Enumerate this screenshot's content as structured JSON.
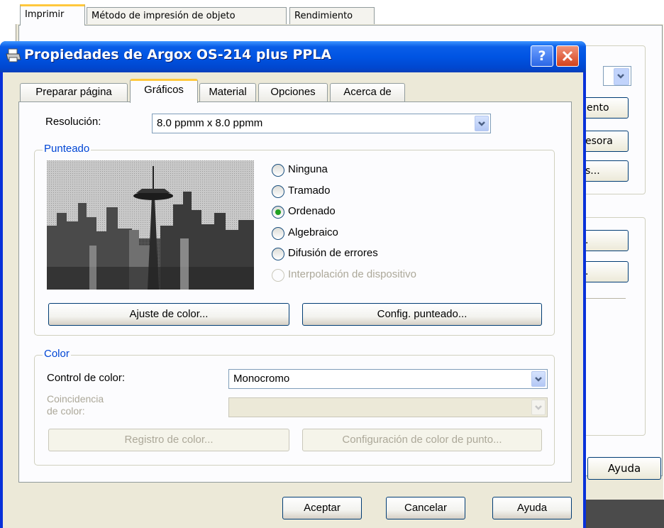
{
  "background_window": {
    "tabs": [
      "Imprimir",
      "Método de impresión de objeto",
      "Rendimiento"
    ],
    "buttons": [
      "ento",
      "esora",
      "s...",
      ".",
      "."
    ],
    "help_button": "Ayuda"
  },
  "dialog": {
    "title": "Propiedades de Argox OS-214 plus PPLA",
    "help_glyph": "?",
    "tabs": [
      "Preparar página",
      "Gráficos",
      "Material",
      "Opciones",
      "Acerca de"
    ],
    "active_tab": "Gráficos",
    "resolution": {
      "label": "Resolución:",
      "value": "8.0 ppmm x 8.0 ppmm"
    },
    "dithering": {
      "group_title": "Punteado",
      "options": [
        {
          "label": "Ninguna",
          "selected": false,
          "enabled": true
        },
        {
          "label": "Tramado",
          "selected": false,
          "enabled": true
        },
        {
          "label": "Ordenado",
          "selected": true,
          "enabled": true
        },
        {
          "label": "Algebraico",
          "selected": false,
          "enabled": true
        },
        {
          "label": "Difusión de errores",
          "selected": false,
          "enabled": true
        },
        {
          "label": "Interpolación de dispositivo",
          "selected": false,
          "enabled": false
        }
      ],
      "color_adjust_button": "Ajuste de color...",
      "dither_config_button": "Config. punteado..."
    },
    "color": {
      "group_title": "Color",
      "control_label": "Control de color:",
      "control_value": "Monocromo",
      "matching_label_line1": "Coincidencia",
      "matching_label_line2": "de color:",
      "matching_value": "",
      "register_button": "Registro de color...",
      "dot_config_button": "Configuración de color de punto..."
    },
    "footer": {
      "ok": "Aceptar",
      "cancel": "Cancelar",
      "help": "Ayuda"
    }
  },
  "colors": {
    "titlebar": "#0054e3",
    "selected_radio": "#21a121",
    "group_title": "#0046d5",
    "tab_highlight": "#ffc83c"
  }
}
